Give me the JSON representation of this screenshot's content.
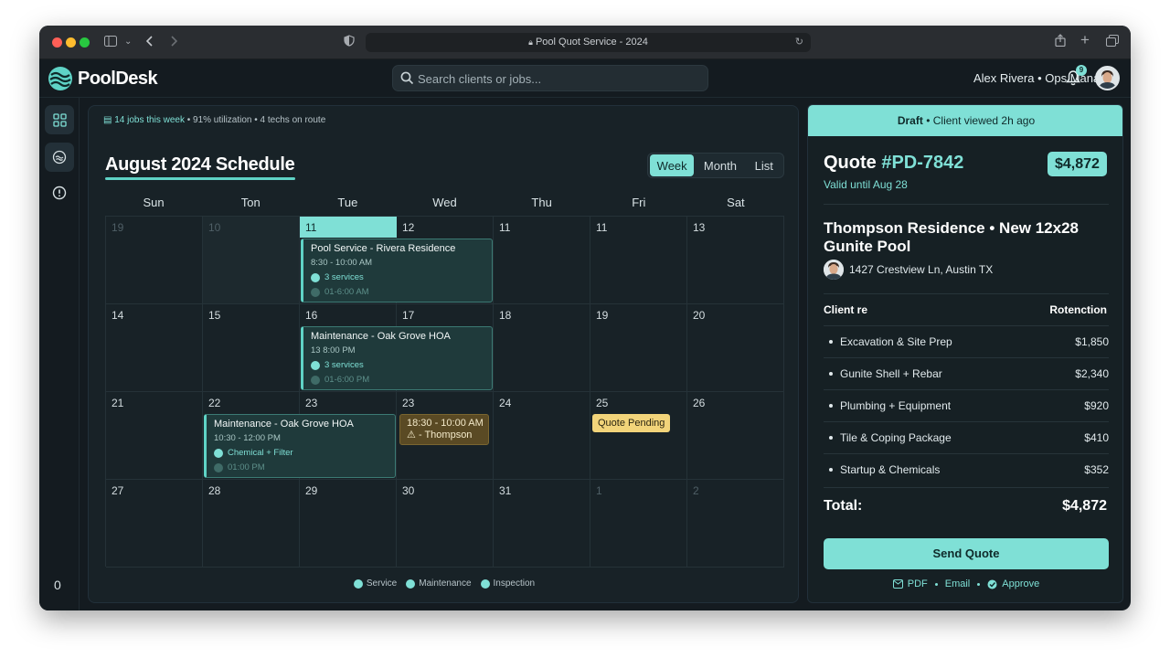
{
  "browser": {
    "url_title": "Pool Quot Service - 2024"
  },
  "app": {
    "brand": "PoolDesk",
    "search_placeholder": "Search clients or jobs...",
    "user": "Alex Rivera • Ops Manager",
    "notifications_count": "9",
    "sidebar_bottom": "0"
  },
  "calendar": {
    "stats_prefix": "14 jobs this week",
    "stats_rest": " • 91% utilization • 4 techs on route",
    "title": "August 2024 Schedule",
    "views": [
      "Week",
      "Month",
      "List"
    ],
    "active_view": "Week",
    "day_names": [
      "Sun",
      "Ton",
      "Tue",
      "Wed",
      "Thu",
      "Fri",
      "Sat"
    ],
    "weeks": [
      [
        "19",
        "10",
        "11",
        "12",
        "11",
        "11",
        "13"
      ],
      [
        "14",
        "15",
        "16",
        "17",
        "18",
        "19",
        "20"
      ],
      [
        "21",
        "22",
        "23",
        "23",
        "24",
        "25",
        "26"
      ],
      [
        "27",
        "28",
        "29",
        "30",
        "31",
        "1",
        "2"
      ]
    ],
    "events": [
      {
        "title": "Pool Service - Rivera Residence",
        "time": "8:30 - 10:00 AM",
        "line1": "3 services",
        "line2": "01-6:00 AM"
      },
      {
        "title": "Maintenance - Oak Grove HOA",
        "time": "13 8:00 PM",
        "line1": "3 services",
        "line2": "01-6:00 PM"
      },
      {
        "title": "Maintenance - Oak Grove HOA",
        "time": "10:30 - 12:00 PM",
        "line1": "Chemical + Filter",
        "line2": "01:00 PM"
      }
    ],
    "warning_event": {
      "time": "18:30 - 10:00 AM",
      "label": "- Thompson"
    },
    "pending_label": "Quote Pending",
    "legend": [
      "Service",
      "Maintenance",
      "Inspection"
    ]
  },
  "quote": {
    "status": "Draft",
    "status_note": "Client viewed 2h ago",
    "label": "Quote",
    "number": "#PD-7842",
    "amount": "$4,872",
    "valid": "Valid until Aug 28",
    "project": "Thompson Residence • New 12x28 Gunite Pool",
    "address": "1427 Crestview Ln, Austin TX",
    "col_left": "Client re",
    "col_right": "Rotenction",
    "lines": [
      {
        "name": "Excavation & Site Prep",
        "value": "$1,850"
      },
      {
        "name": "Gunite Shell + Rebar",
        "value": "$2,340"
      },
      {
        "name": "Plumbing + Equipment",
        "value": "$920"
      },
      {
        "name": "Tile & Coping Package",
        "value": "$410"
      },
      {
        "name": "Startup & Chemicals",
        "value": "$352"
      }
    ],
    "total_label": "Total:",
    "total_value": "$4,872",
    "send_label": "Send Quote",
    "actions": [
      "PDF",
      "Email",
      "Approve"
    ]
  },
  "colors": {
    "accent": "#7fe0d6",
    "background": "#141b20",
    "panel": "#182227",
    "pending": "#f2d47a",
    "warning": "#5a4a24"
  },
  "icons": [
    "sidebar-icon",
    "chevron-down-icon",
    "back-icon",
    "forward-icon",
    "shield-icon",
    "lock-icon",
    "reload-icon",
    "share-icon",
    "plus-icon",
    "tabs-icon",
    "search-icon",
    "bell-icon",
    "grid-icon",
    "pool-icon",
    "info-icon",
    "check-icon",
    "warning-icon",
    "pdf-icon",
    "approve-icon"
  ]
}
